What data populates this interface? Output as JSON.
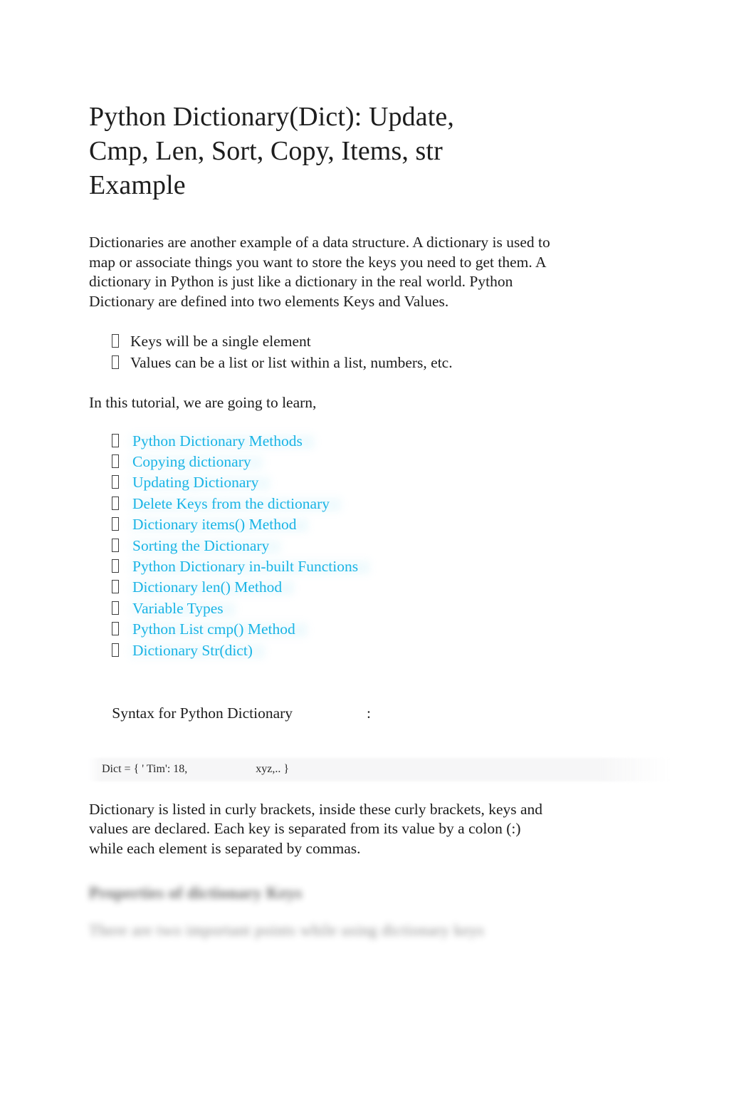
{
  "document": {
    "title": "Python Dictionary(Dict): Update, Cmp, Len, Sort, Copy, Items, str Example"
  },
  "intro": {
    "paragraph": "Dictionaries are another example of a data structure. A dictionary is used to map or associate things you want to store the keys you need to get them. A dictionary in Python is just like a dictionary in the real world. Python Dictionary are defined into two elements Keys and Values."
  },
  "key_value_list": {
    "bullet_glyph": "missing-glyph-box",
    "items": [
      "Keys will be a single element",
      "Values can be a list or list within a list, numbers, etc."
    ]
  },
  "tutorial_lead": {
    "text": "In this tutorial, we are going to learn,"
  },
  "toc": {
    "link_color": "#1ab4e5",
    "bullet_glyph": "missing-glyph-box",
    "items": [
      "Python Dictionary Methods",
      "Copying dictionary",
      "Updating Dictionary",
      "Delete Keys from the dictionary",
      "Dictionary items() Method",
      "Sorting the Dictionary",
      "Python Dictionary in-built Functions",
      "Dictionary len() Method",
      "Variable Types",
      "Python List cmp() Method",
      "Dictionary Str(dict)"
    ]
  },
  "syntax": {
    "label": "Syntax for Python Dictionary",
    "colon": ":",
    "code_left": "Dict = { ' Tim': 18,",
    "code_right": "xyz,.. }",
    "code_background": "#f6f6f7"
  },
  "explanation": {
    "paragraph": "Dictionary is listed in curly brackets, inside these curly brackets, keys and values are declared. Each key is separated from its value by a colon (:) while each element is separated by commas."
  },
  "obscured": {
    "heading": "Properties of dictionary Keys",
    "paragraph": "There are two important points while using dictionary keys"
  }
}
